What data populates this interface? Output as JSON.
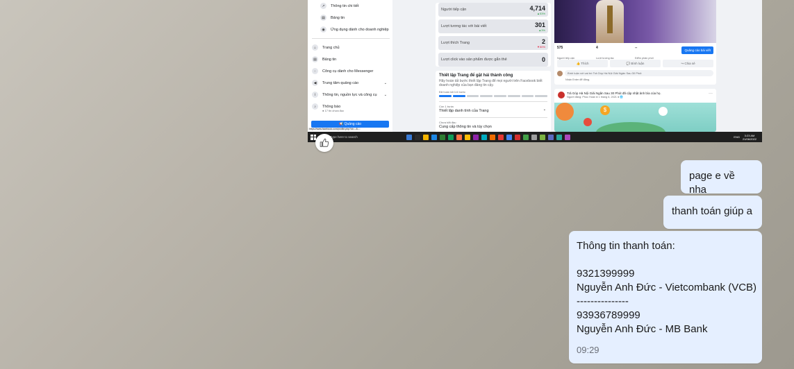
{
  "screenshot": {
    "left_menu": {
      "top_items": [
        "Thông tin chi tiết",
        "Bảng tin",
        "Ứng dụng dành cho doanh nghiệp"
      ],
      "items": [
        "Trang chủ",
        "Bảng tin",
        "Công cụ dành cho Messenger",
        "Trung tâm quảng cáo",
        "Thông tin, nguồn lực và công cụ",
        "Thông báo"
      ],
      "notif_sub": "● 17 tin chưa đọc",
      "ad_button": "📢 Quảng cáo",
      "status_url": "https://www.facebook.com/profile.php?id=...8..."
    },
    "stats": [
      {
        "label": "Người tiếp cận",
        "value": "4,714",
        "change": "▲53%",
        "dir": "up"
      },
      {
        "label": "Lượt tương tác với bài viết",
        "value": "301",
        "change": "▲3%",
        "dir": "up"
      },
      {
        "label": "Lượt thích Trang",
        "value": "2",
        "change": "▼50%",
        "dir": "down"
      },
      {
        "label": "Lượt click vào sản phẩm được gắn thẻ",
        "value": "0",
        "change": "",
        "dir": ""
      }
    ],
    "setup": {
      "title": "Thiết lập Trang để gặt hái thành công",
      "desc": "Hãy hoàn tất bước thiết lập Trang để mọi người trên Facebook biết doanh nghiệp của bạn đáng tin cậy.",
      "progress_label": "Đã hoàn tất 1/4 bước",
      "progress_done": 1,
      "progress_total": 4,
      "steps": [
        {
          "sub": "Còn 1 bước",
          "title": "Thiết lập danh tính của Trang"
        },
        {
          "sub": "Chưa bắt đầu",
          "title": "Cung cấp thông tin và tùy chọn"
        }
      ]
    },
    "post": {
      "stats": [
        {
          "value": "575",
          "label": "Người tiếp cận"
        },
        {
          "value": "4",
          "label": "Lượt tương tác"
        },
        {
          "value": "--",
          "label": "Điểm phân phối"
        }
      ],
      "boost_button": "Quảng cáo bài viết",
      "actions": [
        "👍 Thích",
        "💬 Bình luận",
        "↪ Chia sẻ"
      ],
      "comment_placeholder": "Bình luận với vai trò Trả Góp Hà Nội Giải Ngân Sau 30 Phút",
      "comment_author": "Nhấn Enter để đăng."
    },
    "post2": {
      "title": "Trả Góp Hà Nội Giải Ngân Sau 30 Phút đã cập nhật ảnh bìa của họ.",
      "sub": "Người đăng: Phúc Hoàn ● 1 tháng 6, 2021 ● 🌐",
      "dots": "···"
    },
    "taskbar": {
      "search": "Type here to search",
      "tray": "ENG",
      "time": "3:23 AM",
      "date": "21/06/2022"
    }
  },
  "messages": [
    {
      "text": "page e về nha"
    },
    {
      "text": "thanh toán giúp a"
    },
    {
      "lines": [
        "Thông tin thanh toán:",
        "",
        "9321399999",
        "Nguyễn Anh Đức - Vietcombank (VCB)",
        "---------------",
        "93936789999",
        "Nguyễn Anh Đức - MB Bank"
      ],
      "time": "09:29"
    }
  ],
  "icons": {
    "reaction": "thumbs-up-icon"
  },
  "colors": {
    "bubble": "#e5efff",
    "fb_blue": "#1877f2"
  }
}
